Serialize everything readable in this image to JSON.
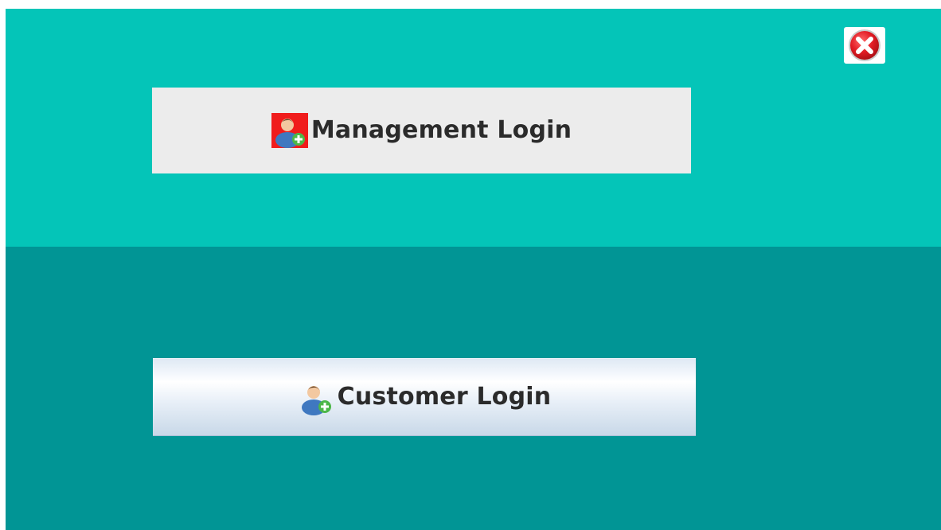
{
  "buttons": {
    "management_login": {
      "label": "Management Login",
      "icon": "user-add-icon-highlighted"
    },
    "customer_login": {
      "label": "Customer Login",
      "icon": "user-add-icon"
    }
  },
  "window_controls": {
    "close_icon": "close-icon"
  },
  "colors": {
    "top_panel": "#04c5b8",
    "bottom_panel": "#019595",
    "management_button": "#ececec",
    "close_red": "#e21b24"
  }
}
